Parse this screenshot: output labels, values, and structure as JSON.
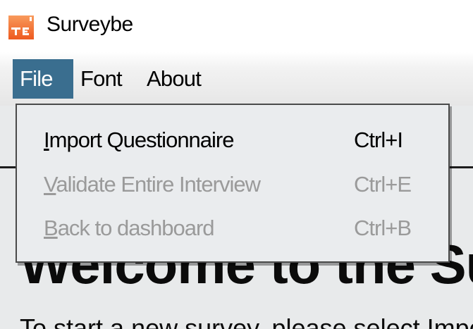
{
  "window": {
    "title": "Surveybe",
    "icon": "surveybe-app-icon"
  },
  "menubar": {
    "items": [
      {
        "label": "File",
        "active": true
      },
      {
        "label": "Font",
        "active": false
      },
      {
        "label": "About",
        "active": false
      }
    ],
    "active_color": "#3a6e8f"
  },
  "file_menu": {
    "items": [
      {
        "mnemonic": "I",
        "rest": "mport Questionnaire",
        "shortcut": "Ctrl+I",
        "enabled": true
      },
      {
        "mnemonic": "V",
        "rest": "alidate Entire Interview",
        "shortcut": "Ctrl+E",
        "enabled": false
      },
      {
        "mnemonic": "B",
        "rest": "ack to dashboard",
        "shortcut": "Ctrl+B",
        "enabled": false
      }
    ]
  },
  "content": {
    "heading_partial": "Welcome to the Surv",
    "body_partial": "To start a new survey, please select Import... Th"
  },
  "colors": {
    "content_bg": "#e8eaeb",
    "disabled_text": "#9a9a9a",
    "app_icon": "#f26a2a"
  }
}
